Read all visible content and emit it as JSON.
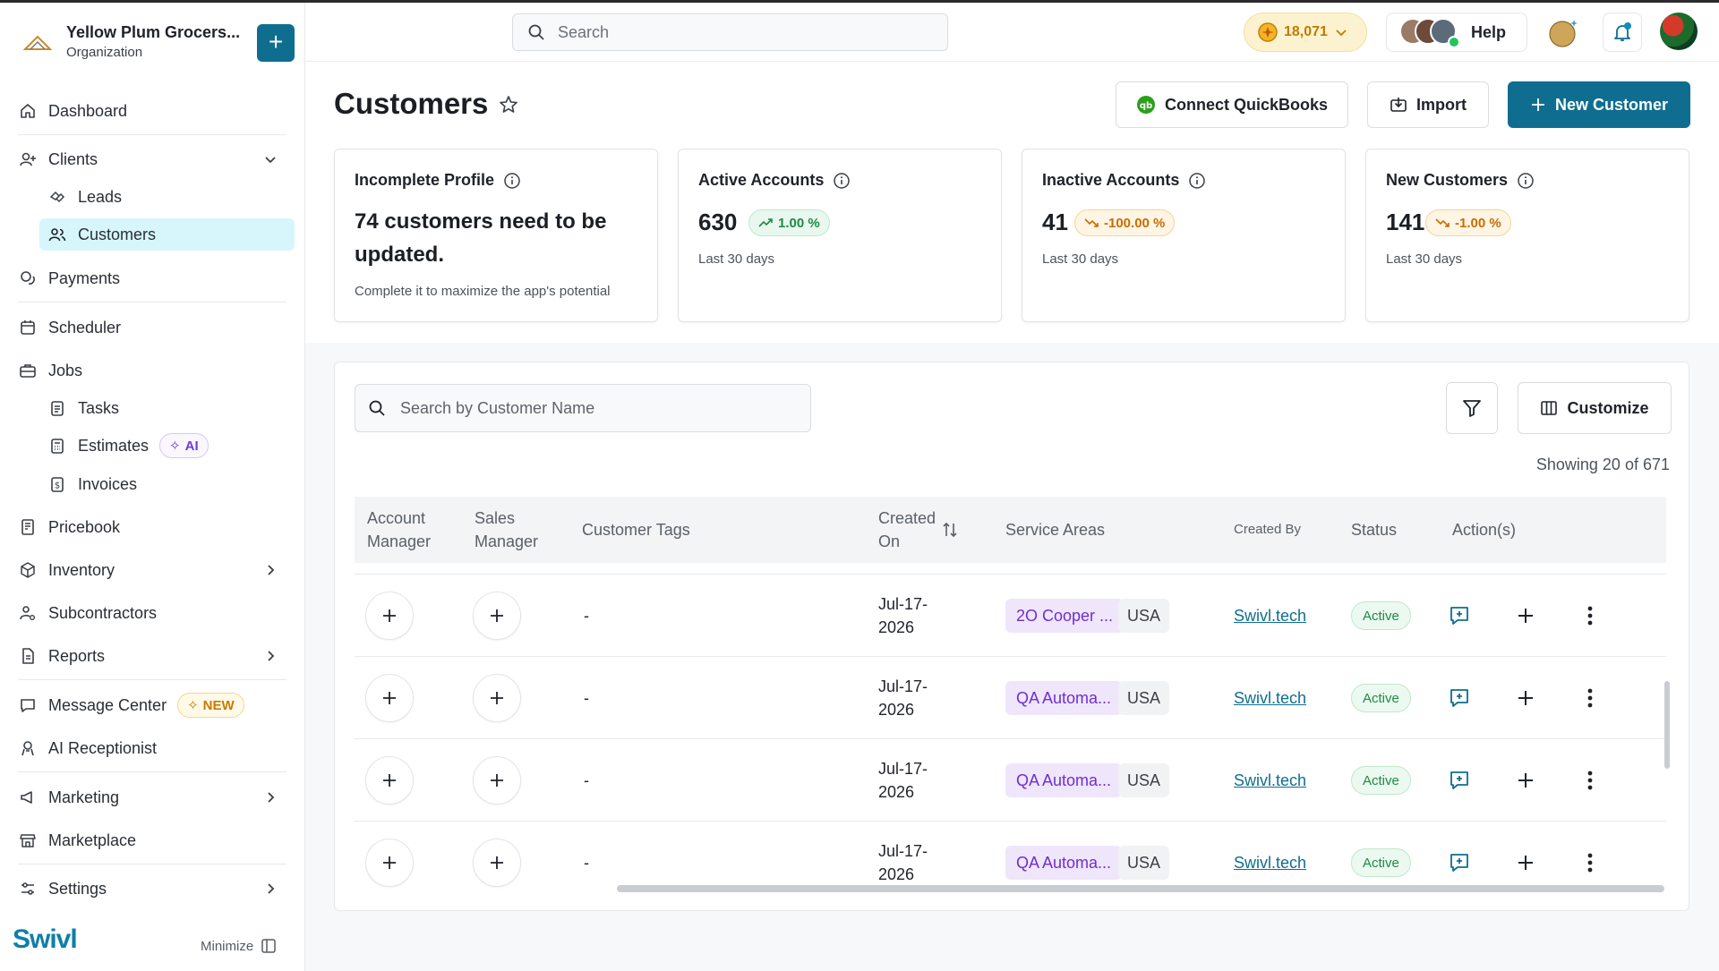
{
  "org": {
    "name": "Yellow Plum Grocers...",
    "subtitle": "Organization",
    "add_label": "+"
  },
  "sidebar": {
    "items": [
      {
        "label": "Dashboard"
      },
      {
        "label": "Clients"
      },
      {
        "label": "Leads"
      },
      {
        "label": "Customers"
      },
      {
        "label": "Payments"
      },
      {
        "label": "Scheduler"
      },
      {
        "label": "Jobs"
      },
      {
        "label": "Tasks"
      },
      {
        "label": "Estimates",
        "badge": "AI"
      },
      {
        "label": "Invoices"
      },
      {
        "label": "Pricebook"
      },
      {
        "label": "Inventory"
      },
      {
        "label": "Subcontractors"
      },
      {
        "label": "Reports"
      },
      {
        "label": "Message Center",
        "badge": "NEW"
      },
      {
        "label": "AI Receptionist"
      },
      {
        "label": "Marketing"
      },
      {
        "label": "Marketplace"
      },
      {
        "label": "Settings"
      }
    ],
    "brand": "Swivl",
    "minimize_label": "Minimize"
  },
  "topbar": {
    "search_placeholder": "Search",
    "coins": "18,071",
    "help_label": "Help"
  },
  "page": {
    "title": "Customers",
    "buttons": {
      "quickbooks": "Connect QuickBooks",
      "import": "Import",
      "new_customer": "New Customer"
    }
  },
  "cards": {
    "incomplete": {
      "title": "Incomplete Profile",
      "message": "74 customers need to be updated.",
      "note": "Complete it to maximize the app's potential"
    },
    "active": {
      "title": "Active Accounts",
      "value": "630",
      "delta": "1.00 %",
      "period": "Last 30 days"
    },
    "inactive": {
      "title": "Inactive Accounts",
      "value": "41",
      "delta": "-100.00 %",
      "period": "Last 30 days"
    },
    "new": {
      "title": "New Customers",
      "value": "141",
      "delta": "-1.00 %",
      "period": "Last 30 days"
    }
  },
  "table": {
    "search_placeholder": "Search by Customer Name",
    "customize_label": "Customize",
    "showing": "Showing 20 of 671",
    "columns": {
      "account_manager": "Account Manager",
      "sales_manager": "Sales Manager",
      "customer_tags": "Customer Tags",
      "created_on": "Created On",
      "service_areas": "Service Areas",
      "created_by": "Created By",
      "status": "Status",
      "actions": "Action(s)"
    },
    "rows": [
      {
        "tags": "-",
        "created_on": "Jul-17-2026",
        "service_area": "2O Cooper ...",
        "country": "USA",
        "created_by": "Swivl.tech",
        "status": "Active"
      },
      {
        "tags": "-",
        "created_on": "Jul-17-2026",
        "service_area": "QA Automa...",
        "country": "USA",
        "created_by": "Swivl.tech",
        "status": "Active"
      },
      {
        "tags": "-",
        "created_on": "Jul-17-2026",
        "service_area": "QA Automa...",
        "country": "USA",
        "created_by": "Swivl.tech",
        "status": "Active"
      },
      {
        "tags": "-",
        "created_on": "Jul-17-2026",
        "service_area": "QA Automa...",
        "country": "USA",
        "created_by": "Swivl.tech",
        "status": "Active"
      }
    ]
  },
  "colors": {
    "accent": "#0f6e8f",
    "active_nav_bg": "#d6f6fb",
    "tag_purple": "#6f2ed3",
    "status_green": "#1f8a45"
  }
}
